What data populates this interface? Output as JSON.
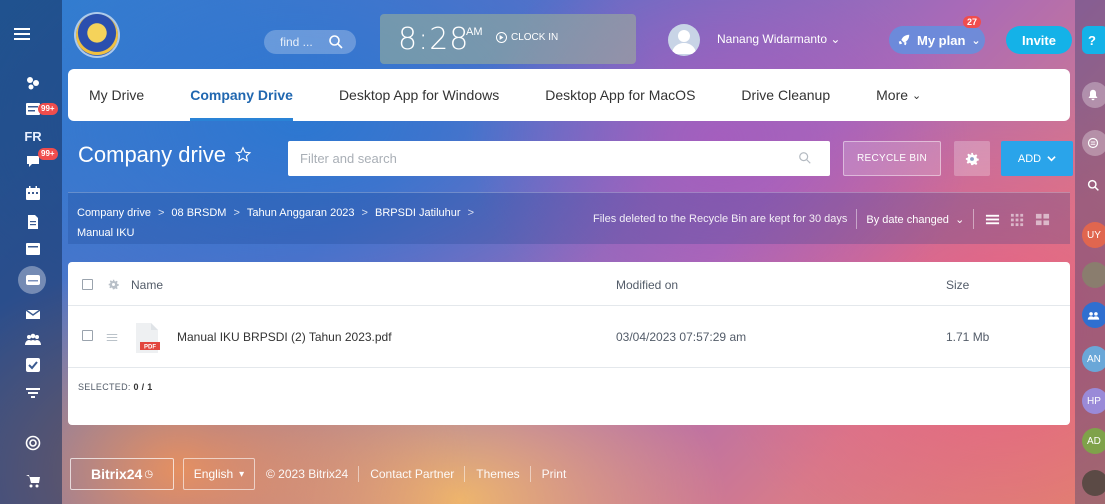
{
  "header": {
    "search_placeholder": "find ...",
    "clock": {
      "time": "8:28",
      "ampm": "AM",
      "clock_in_label": "CLOCK IN"
    },
    "user_name": "Nanang Widarmanto",
    "my_plan": {
      "label": "My plan",
      "badge": "27"
    },
    "invite_label": "Invite",
    "help_label": "?"
  },
  "left_rail": {
    "badges": {
      "feed": "99+",
      "chat": "99+"
    },
    "fr_label": "FR"
  },
  "right_rail": {
    "avatars": [
      "UY",
      "AN",
      "HP",
      "AD"
    ]
  },
  "tabs": [
    {
      "label": "My Drive"
    },
    {
      "label": "Company Drive"
    },
    {
      "label": "Desktop App for Windows"
    },
    {
      "label": "Desktop App for MacOS"
    },
    {
      "label": "Drive Cleanup"
    },
    {
      "label": "More"
    }
  ],
  "page": {
    "title": "Company drive",
    "filter_placeholder": "Filter and search",
    "recycle_bin_label": "RECYCLE BIN",
    "add_label": "ADD"
  },
  "breadcrumbs": [
    "Company drive",
    "08 BRSDM",
    "Tahun Anggaran 2023",
    "BRPSDI Jatiluhur",
    "Manual IKU"
  ],
  "toolbar": {
    "recycle_note": "Files deleted to the Recycle Bin are kept for 30 days",
    "sort_label": "By date changed"
  },
  "table": {
    "columns": {
      "name": "Name",
      "modified": "Modified on",
      "size": "Size"
    },
    "rows": [
      {
        "name": "Manual IKU BRPSDI (2) Tahun 2023.pdf",
        "modified": "03/04/2023 07:57:29 am",
        "size": "1.71 Mb",
        "file_type": "PDF"
      }
    ],
    "selected_label": "SELECTED:",
    "selected_count": "0 / 1"
  },
  "footer": {
    "brand": "Bitrix24",
    "language": "English",
    "copyright": "© 2023 Bitrix24",
    "links": [
      "Contact Partner",
      "Themes",
      "Print"
    ]
  }
}
